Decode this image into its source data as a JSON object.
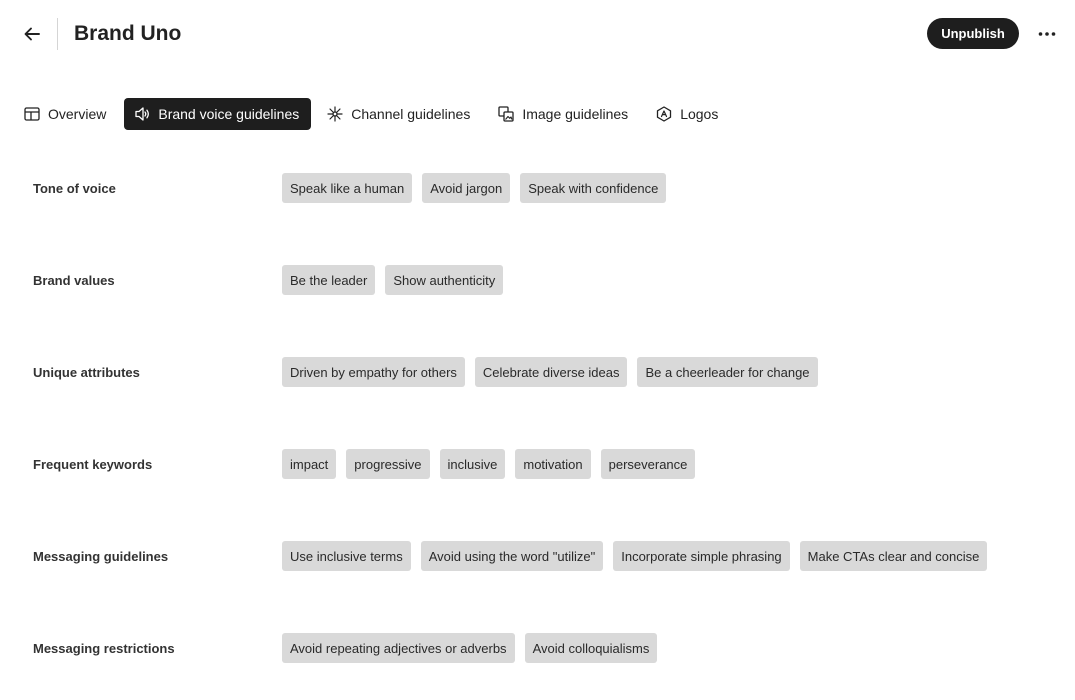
{
  "header": {
    "title": "Brand Uno",
    "back_icon": "arrow-left-icon",
    "unpublish_label": "Unpublish",
    "more_icon": "more-horizontal-icon"
  },
  "tabs": [
    {
      "label": "Overview",
      "icon": "layout-icon",
      "active": false
    },
    {
      "label": "Brand voice guidelines",
      "icon": "speaker-icon",
      "active": true
    },
    {
      "label": "Channel guidelines",
      "icon": "network-icon",
      "active": false
    },
    {
      "label": "Image guidelines",
      "icon": "images-icon",
      "active": false
    },
    {
      "label": "Logos",
      "icon": "logo-badge-icon",
      "active": false
    }
  ],
  "sections": [
    {
      "label": "Tone of voice",
      "tags": [
        "Speak like a human",
        "Avoid jargon",
        "Speak with confidence"
      ]
    },
    {
      "label": "Brand values",
      "tags": [
        "Be the leader",
        "Show authenticity"
      ]
    },
    {
      "label": "Unique attributes",
      "tags": [
        "Driven by empathy for others",
        "Celebrate diverse ideas",
        "Be a cheerleader for change"
      ]
    },
    {
      "label": "Frequent keywords",
      "tags": [
        "impact",
        "progressive",
        "inclusive",
        "motivation",
        "perseverance"
      ]
    },
    {
      "label": "Messaging guidelines",
      "tags": [
        "Use inclusive terms",
        "Avoid using the word \"utilize\"",
        "Incorporate simple phrasing",
        "Make CTAs clear and concise"
      ]
    },
    {
      "label": "Messaging restrictions",
      "tags": [
        "Avoid repeating adjectives or adverbs",
        "Avoid colloquialisms"
      ]
    }
  ],
  "colors": {
    "primary_dark": "#1e1e1e",
    "tag_background": "#d9d9d9",
    "text": "#222222"
  }
}
